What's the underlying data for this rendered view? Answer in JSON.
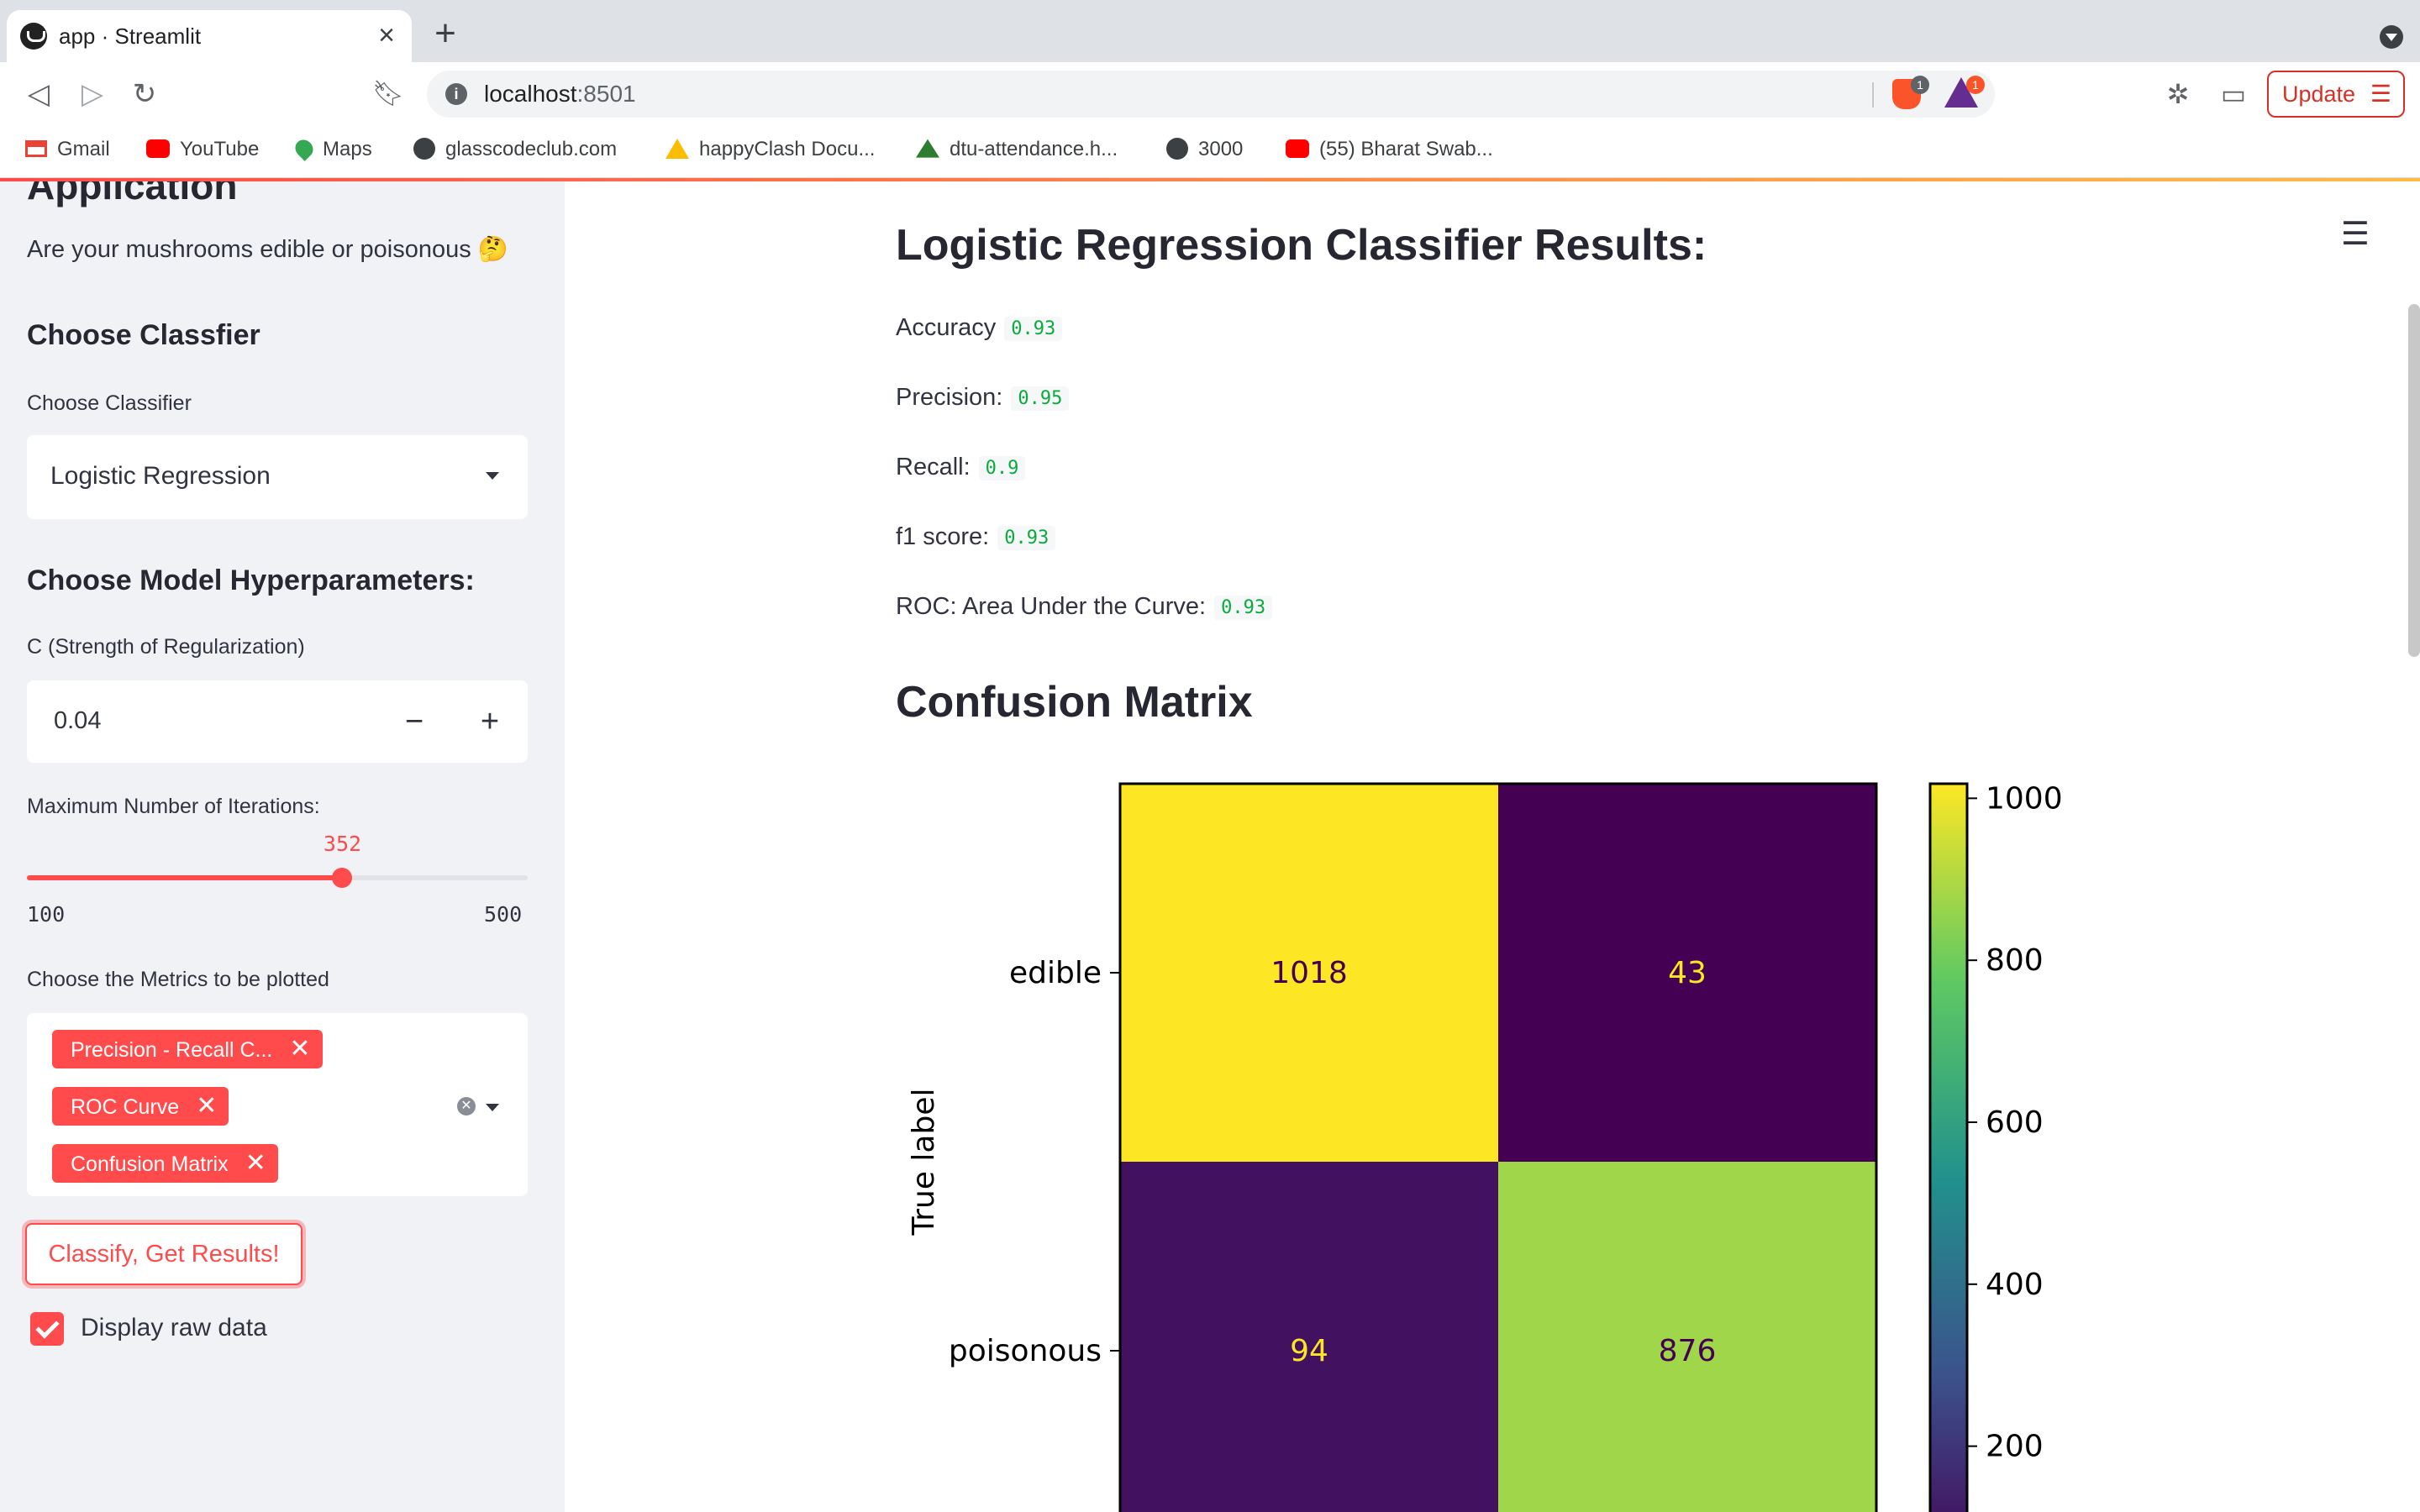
{
  "browser": {
    "tab_title": "app · Streamlit",
    "url_host": "localhost",
    "url_port": ":8501",
    "update_label": "Update",
    "brave_badge": "1",
    "rewards_badge": "1",
    "bookmarks": [
      "Gmail",
      "YouTube",
      "Maps",
      "glasscodeclub.com",
      "happyClash Docu...",
      "dtu-attendance.h...",
      "3000",
      "(55) Bharat Swab..."
    ]
  },
  "sidebar": {
    "heading_partial": "Application",
    "subtitle": "Are your mushrooms edible or poisonous 🤔",
    "choose_classifier_heading": "Choose Classfier",
    "choose_classifier_label": "Choose Classifier",
    "classifier_value": "Logistic Regression",
    "hyperparams_heading": "Choose Model Hyperparameters:",
    "c_label": "C (Strength of Regularization)",
    "c_value": "0.04",
    "minus": "−",
    "plus": "+",
    "iterations_label": "Maximum Number of Iterations:",
    "iterations_value": 352,
    "iterations_value_text": "352",
    "iterations_min": "100",
    "iterations_max": "500",
    "metrics_label": "Choose the Metrics to be plotted",
    "metrics_chips": [
      "Precision - Recall C...",
      "ROC Curve",
      "Confusion Matrix"
    ],
    "classify_button": "Classify, Get Results!",
    "display_raw_label": "Display raw data",
    "display_raw_checked": true,
    "accent_color": "#ff4b4b"
  },
  "main": {
    "results_title": "Logistic Regression Classifier Results:",
    "metrics": [
      {
        "label": "Accuracy",
        "value": "0.93"
      },
      {
        "label": "Precision:",
        "value": "0.95"
      },
      {
        "label": "Recall:",
        "value": "0.9"
      },
      {
        "label": "f1 score:",
        "value": "0.93"
      },
      {
        "label": "ROC: Area Under the Curve:",
        "value": "0.93"
      }
    ],
    "confusion_title": "Confusion Matrix",
    "hamburger_icon": "hamburger-menu-icon"
  },
  "chart_data": {
    "type": "heatmap",
    "rows": [
      "edible",
      "poisonous"
    ],
    "ylabel": "True label",
    "values": [
      [
        1018,
        43
      ],
      [
        94,
        876
      ]
    ],
    "colormap": "viridis",
    "colorbar_ticks": [
      1000,
      800,
      600,
      400,
      200
    ],
    "colorbar_range": [
      43,
      1018
    ]
  }
}
